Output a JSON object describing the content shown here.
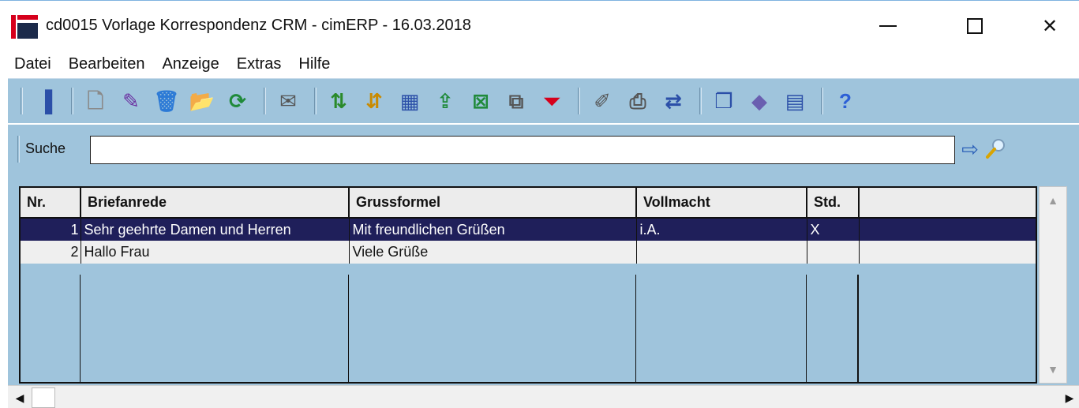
{
  "window": {
    "title": "cd0015 Vorlage Korrespondenz CRM - cimERP - 16.03.2018",
    "controls": {
      "minimize": "—",
      "maximize": "☐",
      "close": "✕"
    }
  },
  "menu": {
    "items": [
      "Datei",
      "Bearbeiten",
      "Anzeige",
      "Extras",
      "Hilfe"
    ]
  },
  "toolbar": {
    "buttons": [
      {
        "name": "exit-icon",
        "glyph": "▐",
        "color": "#2b4fa8"
      },
      {
        "name": "new-document-icon",
        "glyph": "🗋",
        "color": "#8a8a8a"
      },
      {
        "name": "edit-pencil-icon",
        "glyph": "✎",
        "color": "#6a2fa0"
      },
      {
        "name": "delete-bin-icon",
        "glyph": "🗑",
        "color": "#2c7ad6"
      },
      {
        "name": "copy-folder-icon",
        "glyph": "📂",
        "color": "#c9a100"
      },
      {
        "name": "refresh-icon",
        "glyph": "⟳",
        "color": "#1f8a3a"
      },
      {
        "name": "mail-icon",
        "glyph": "✉",
        "color": "#555555"
      },
      {
        "name": "sort-ascending-icon",
        "glyph": "⇅",
        "color": "#2a8a2a"
      },
      {
        "name": "sort-descending-icon",
        "glyph": "⇵",
        "color": "#c98a00"
      },
      {
        "name": "numbering-icon",
        "glyph": "▦",
        "color": "#2b4fa8"
      },
      {
        "name": "export-icon",
        "glyph": "⇪",
        "color": "#1f8a3a"
      },
      {
        "name": "excel-icon",
        "glyph": "⊠",
        "color": "#1f8a3a"
      },
      {
        "name": "copy-icon",
        "glyph": "⧉",
        "color": "#555555"
      },
      {
        "name": "filter-icon",
        "glyph": "⏷",
        "color": "#d6001c"
      },
      {
        "name": "properties-icon",
        "glyph": "✐",
        "color": "#555555"
      },
      {
        "name": "print-icon",
        "glyph": "⎙",
        "color": "#555555"
      },
      {
        "name": "transfer-icon",
        "glyph": "⇄",
        "color": "#2b4fa8"
      },
      {
        "name": "windows-icon",
        "glyph": "❐",
        "color": "#2b4fa8"
      },
      {
        "name": "book-icon",
        "glyph": "◆",
        "color": "#6a5fb0"
      },
      {
        "name": "calendar-icon",
        "glyph": "▤",
        "color": "#2b4fa8"
      },
      {
        "name": "help-icon",
        "glyph": "?",
        "color": "#2c5fd6"
      }
    ]
  },
  "search": {
    "label": "Suche",
    "value": "",
    "go_glyph": "⇨"
  },
  "table": {
    "columns": [
      "Nr.",
      "Briefanrede",
      "Grussformel",
      "Vollmacht",
      "Std.",
      ""
    ],
    "rows": [
      {
        "nr": "1",
        "briefanrede": "Sehr geehrte Damen und Herren",
        "grussformel": "Mit freundlichen Grüßen",
        "vollmacht": "i.A.",
        "std": "X",
        "extra": "",
        "selected": true
      },
      {
        "nr": "2",
        "briefanrede": "Hallo Frau",
        "grussformel": "Viele Grüße",
        "vollmacht": "",
        "std": "",
        "extra": "",
        "selected": false
      }
    ]
  },
  "scrollbars": {
    "up": "▲",
    "down": "▼",
    "left": "◀",
    "right": "▶"
  },
  "colors": {
    "accent_bg": "#9fc4dc",
    "selected_row": "#1f1f5a",
    "brand_red": "#d6001c"
  }
}
